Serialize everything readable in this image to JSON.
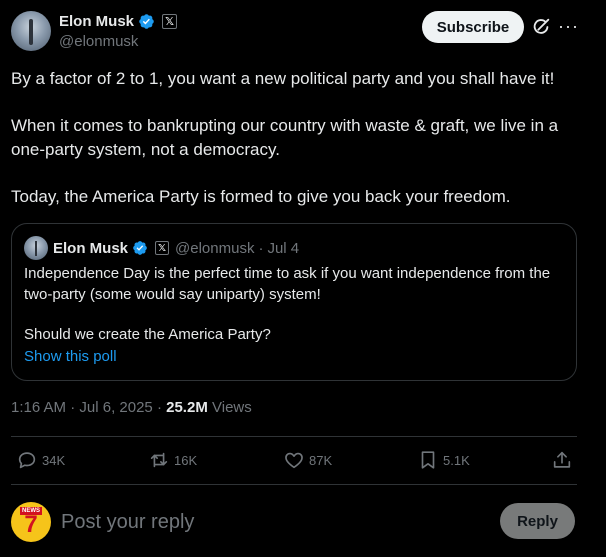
{
  "post": {
    "author_name": "Elon Musk",
    "author_handle": "@elonmusk",
    "subscribe_label": "Subscribe",
    "more_label": "···",
    "paragraphs": [
      "By a factor of 2 to 1, you want a new political party and you shall have it!",
      "When it comes to bankrupting our country with waste & graft, we live in a one-party system, not a democracy.",
      "Today, the America Party is formed to give you back your freedom."
    ],
    "time": "1:16 AM",
    "date": "Jul 6, 2025",
    "views_count": "25.2M",
    "views_label": "Views"
  },
  "quote": {
    "author_name": "Elon Musk",
    "author_handle": "@elonmusk",
    "date": "Jul 4",
    "paragraphs": [
      "Independence Day is the perfect time to ask if you want independence from the two-party (some would say uniparty) system!",
      "Should we create the America Party?"
    ],
    "poll_link": "Show this poll"
  },
  "actions": {
    "replies": "34K",
    "reposts": "16K",
    "likes": "87K",
    "bookmarks": "5.1K"
  },
  "composer": {
    "placeholder": "Post your reply",
    "reply_label": "Reply",
    "avatar_badge": "NEWS",
    "avatar_number": "7"
  },
  "colors": {
    "background": "#000000",
    "text": "#e7e9ea",
    "secondary": "#71767b",
    "accent": "#1d9bf0",
    "verified": "#1d9bf0",
    "divider": "#2f3336"
  },
  "icons": {
    "verified": "verified-badge-icon",
    "x_badge": "x-logo-icon",
    "grok": "grok-icon",
    "more": "more-icon",
    "reply": "reply-icon",
    "repost": "repost-icon",
    "like": "heart-icon",
    "bookmark": "bookmark-icon",
    "share": "share-icon"
  }
}
